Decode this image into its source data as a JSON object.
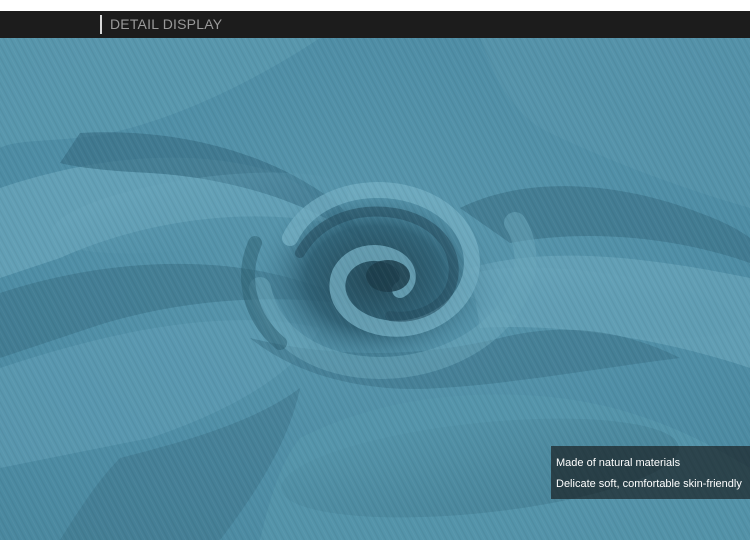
{
  "header": {
    "title": "DETAIL DISPLAY"
  },
  "photo": {
    "subject_icon": "fabric-swirl-photo",
    "base_color": "#4f8ea6",
    "light_color": "#6ba7bd",
    "dark_color": "#2d5e72",
    "header_bg": "#1c1c1c",
    "header_text_color": "#9a9a9a"
  },
  "caption": {
    "line1": "Made of natural materials",
    "line2": "Delicate soft, comfortable skin-friendly"
  }
}
